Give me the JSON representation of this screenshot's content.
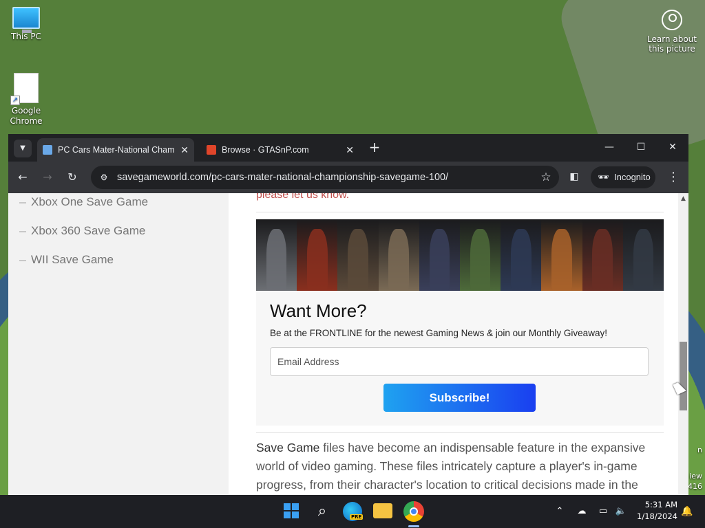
{
  "desktop": {
    "icons": [
      {
        "label": "This PC"
      },
      {
        "label": "Google\nChrome"
      }
    ],
    "learn_about": "Learn about this picture",
    "right_fragments": [
      "n",
      "iew",
      "416"
    ]
  },
  "browser": {
    "tabs": [
      {
        "title": "PC Cars Mater-National Champ",
        "favicon": "save-disk-icon",
        "active": true
      },
      {
        "title": "Browse · GTASnP.com",
        "favicon": "gtasnp-icon",
        "active": false
      }
    ],
    "address": {
      "url": "savegameworld.com/pc-cars-mater-national-championship-savegame-100/"
    },
    "incognito_label": "Incognito"
  },
  "page": {
    "sidebar": {
      "items": [
        {
          "label": "Xbox One Save Game"
        },
        {
          "label": "Xbox 360 Save Game"
        },
        {
          "label": "WII Save Game"
        }
      ]
    },
    "partial_link": "please let us know.",
    "promo": {
      "heading": "Want More?",
      "subtitle": "Be at the FRONTLINE for the newest Gaming News & join our Monthly Giveaway!",
      "email_placeholder": "Email Address",
      "button_label": "Subscribe!",
      "banner_colors": [
        "#6c6f74",
        "#8a2f1e",
        "#5b4a3a",
        "#7a6a55",
        "#3a3f5a",
        "#4d6a3a",
        "#2e3a55",
        "#a8612a",
        "#6a2e24",
        "#333a44"
      ]
    },
    "body": {
      "lead": "Save Game",
      "text": " files have become an indispensable feature in the expansive world of video gaming. These files intricately capture a player's in-game progress, from their character's location to critical decisions made in the storyline,"
    }
  },
  "taskbar": {
    "time": "5:31 AM",
    "date": "1/18/2024",
    "edge_badge": "PRE"
  }
}
